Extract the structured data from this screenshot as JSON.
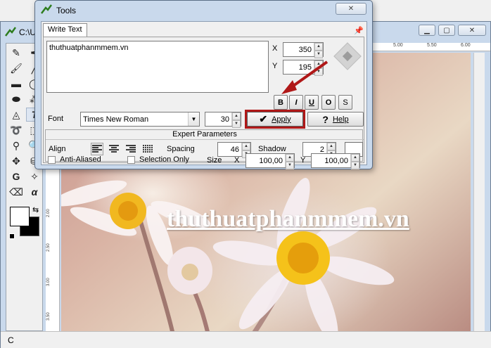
{
  "main_window": {
    "title": "C:\\U",
    "status": "C",
    "vertical_ruler_ticks": [
      "2.00",
      "2.50",
      "3.00",
      "3.50"
    ],
    "horizontal_ruler_ticks": [
      "5.00",
      "5.50",
      "6.00"
    ],
    "canvas_watermark": "thuthuatphanmmem.vn"
  },
  "tools_dialog": {
    "title": "Tools",
    "tab_label": "Write Text",
    "text_value": "thuthuatphanmmem.vn",
    "x_label": "X",
    "x_value": "350",
    "y_label": "Y",
    "y_value": "195",
    "format_buttons": [
      "B",
      "I",
      "U",
      "O",
      "S"
    ],
    "font_label": "Font",
    "font_value": "Times New Roman",
    "font_size": "30",
    "apply_label": "Apply",
    "help_label": "Help",
    "expert_title": "Expert Parameters",
    "align_label": "Align",
    "spacing_label": "Spacing",
    "spacing_value": "46",
    "shadow_label": "Shadow",
    "shadow_value": "2",
    "anti_aliased_label": "Anti-Aliased",
    "selection_only_label": "Selection Only",
    "size_label": "Size",
    "size_x_label": "X",
    "size_x_value": "100,00",
    "size_y_label": "Y",
    "size_y_value": "100,00"
  },
  "colors": {
    "highlight": "#b01818",
    "title_bar": "#c9d9ec"
  }
}
